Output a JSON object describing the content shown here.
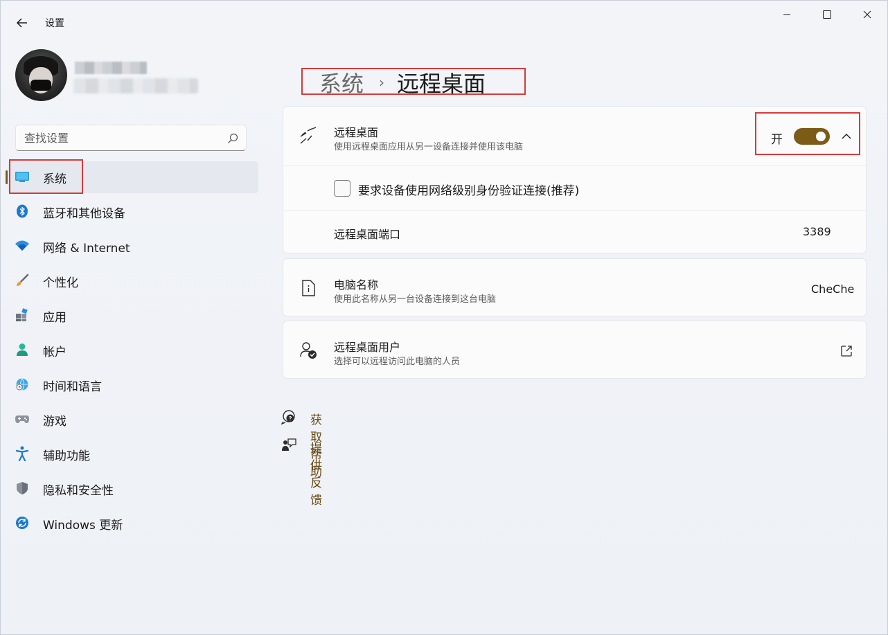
{
  "window": {
    "title": "设置",
    "controls": [
      "minimize",
      "maximize",
      "close"
    ]
  },
  "search": {
    "placeholder": "查找设置"
  },
  "sidebar": {
    "items": [
      {
        "label": "系统",
        "icon": "monitor-icon",
        "active": true
      },
      {
        "label": "蓝牙和其他设备",
        "icon": "bluetooth-icon"
      },
      {
        "label": "网络 & Internet",
        "icon": "wifi-icon"
      },
      {
        "label": "个性化",
        "icon": "brush-icon"
      },
      {
        "label": "应用",
        "icon": "apps-icon"
      },
      {
        "label": "帐户",
        "icon": "account-icon"
      },
      {
        "label": "时间和语言",
        "icon": "globe-clock-icon"
      },
      {
        "label": "游戏",
        "icon": "gamepad-icon"
      },
      {
        "label": "辅助功能",
        "icon": "accessibility-icon"
      },
      {
        "label": "隐私和安全性",
        "icon": "shield-icon"
      },
      {
        "label": "Windows 更新",
        "icon": "update-icon"
      }
    ]
  },
  "breadcrumb": {
    "parent": "系统",
    "separator": "›",
    "current": "远程桌面"
  },
  "remote_desktop": {
    "title": "远程桌面",
    "description": "使用远程桌面应用从另一设备连接并使用该电脑",
    "toggle_state_label": "开",
    "toggle_on": true,
    "nla_checkbox_label": "要求设备使用网络级别身份验证连接(推荐)",
    "nla_checked": false,
    "port_label": "远程桌面端口",
    "port_value": "3389"
  },
  "pc_name": {
    "title": "电脑名称",
    "description": "使用此名称从另一台设备连接到这台电脑",
    "value": "CheChe"
  },
  "remote_users": {
    "title": "远程桌面用户",
    "description": "选择可以远程访问此电脑的人员"
  },
  "links": {
    "help": "获取帮助",
    "feedback": "提供反馈"
  },
  "colors": {
    "accent": "#7c5b17",
    "link": "#6a4a14",
    "highlight_box": "#d63a3a"
  }
}
